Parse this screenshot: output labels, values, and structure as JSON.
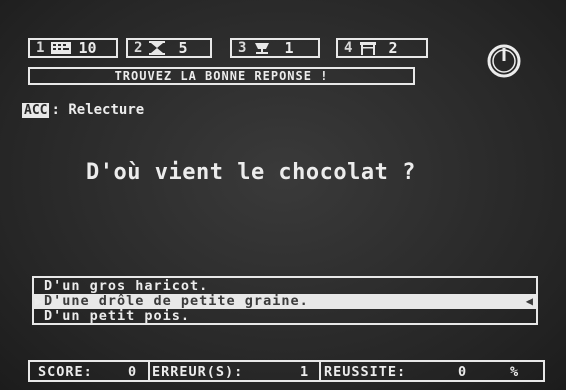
{
  "topbar": {
    "slots": [
      {
        "num": "1",
        "icon": "keyboard-icon",
        "value": "10"
      },
      {
        "num": "2",
        "icon": "hourglass-icon",
        "value": "5"
      },
      {
        "num": "3",
        "icon": "lamp-icon",
        "value": "1"
      },
      {
        "num": "4",
        "icon": "gate-icon",
        "value": "2"
      }
    ],
    "strip_text": "TROUVEZ LA BONNE REPONSE !",
    "power_icon": "power-icon"
  },
  "mode": {
    "tag": "ACC",
    "label": ": Relecture"
  },
  "question": "D'où vient le chocolat ?",
  "answers": [
    {
      "text": "D'un gros haricot."
    },
    {
      "text": "D'une drôle de petite graine.",
      "selected": true
    },
    {
      "text": "D'un petit pois."
    }
  ],
  "status": {
    "score_label": "SCORE:",
    "score_value": "0",
    "errors_label": "ERREUR(S):",
    "errors_value": "1",
    "success_label": "REUSSITE:",
    "success_value": "0",
    "percent": "%"
  },
  "colors": {
    "background": "#2b2b2b",
    "foreground": "#ececec"
  }
}
